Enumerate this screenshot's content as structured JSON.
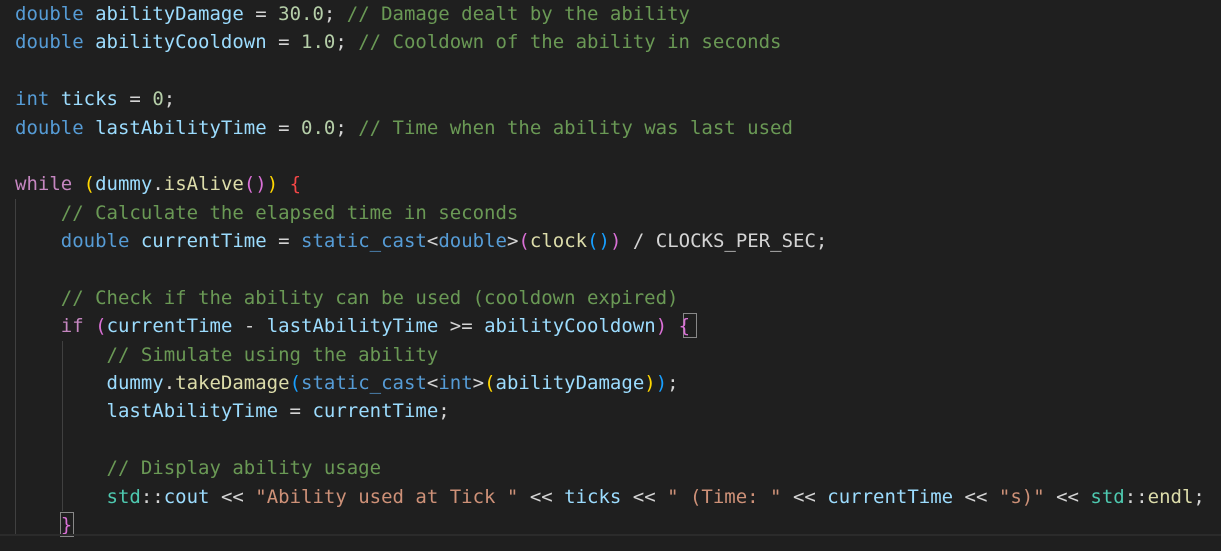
{
  "theme": {
    "background": "#1f1f1f",
    "keyword": "#569cd6",
    "control": "#c586c0",
    "variable": "#9cdcfe",
    "function": "#dcdcaa",
    "number": "#b5cea8",
    "comment": "#6a9955",
    "string": "#ce9178",
    "type": "#4ec9b0",
    "plain": "#d4d4d4",
    "bracket_1": "#ffd700",
    "bracket_2": "#da70d6",
    "bracket_3": "#179fff"
  },
  "code_lines": [
    {
      "role": "decl",
      "tokens": [
        {
          "t": "double",
          "c": "keyword"
        },
        {
          "t": " ",
          "c": "plain"
        },
        {
          "t": "abilityDamage",
          "c": "variable"
        },
        {
          "t": " = ",
          "c": "plain"
        },
        {
          "t": "30.0",
          "c": "number"
        },
        {
          "t": "; ",
          "c": "plain"
        },
        {
          "t": "// Damage dealt by the ability",
          "c": "comment"
        }
      ]
    },
    {
      "role": "decl",
      "tokens": [
        {
          "t": "double",
          "c": "keyword"
        },
        {
          "t": " ",
          "c": "plain"
        },
        {
          "t": "abilityCooldown",
          "c": "variable"
        },
        {
          "t": " = ",
          "c": "plain"
        },
        {
          "t": "1.0",
          "c": "number"
        },
        {
          "t": "; ",
          "c": "plain"
        },
        {
          "t": "// Cooldown of the ability in seconds",
          "c": "comment"
        }
      ]
    },
    {
      "role": "blank",
      "tokens": []
    },
    {
      "role": "decl",
      "tokens": [
        {
          "t": "int",
          "c": "keyword"
        },
        {
          "t": " ",
          "c": "plain"
        },
        {
          "t": "ticks",
          "c": "variable"
        },
        {
          "t": " = ",
          "c": "plain"
        },
        {
          "t": "0",
          "c": "number"
        },
        {
          "t": ";",
          "c": "plain"
        }
      ]
    },
    {
      "role": "decl",
      "tokens": [
        {
          "t": "double",
          "c": "keyword"
        },
        {
          "t": " ",
          "c": "plain"
        },
        {
          "t": "lastAbilityTime",
          "c": "variable"
        },
        {
          "t": " = ",
          "c": "plain"
        },
        {
          "t": "0.0",
          "c": "number"
        },
        {
          "t": "; ",
          "c": "plain"
        },
        {
          "t": "// Time when the ability was last used",
          "c": "comment"
        }
      ]
    },
    {
      "role": "blank",
      "tokens": []
    },
    {
      "role": "loop",
      "tokens": [
        {
          "t": "while",
          "c": "control"
        },
        {
          "t": " ",
          "c": "plain"
        },
        {
          "t": "(",
          "c": "bracket_1"
        },
        {
          "t": "dummy",
          "c": "variable"
        },
        {
          "t": ".",
          "c": "plain"
        },
        {
          "t": "isAlive",
          "c": "function"
        },
        {
          "t": "()",
          "c": "bracket_2"
        },
        {
          "t": ")",
          "c": "bracket_1"
        },
        {
          "t": " ",
          "c": "plain"
        },
        {
          "t": "{",
          "c": "red"
        }
      ]
    },
    {
      "role": "comment",
      "tokens": [
        {
          "t": "    ",
          "c": "plain"
        },
        {
          "t": "// Calculate the elapsed time in seconds",
          "c": "comment"
        }
      ]
    },
    {
      "role": "decl",
      "tokens": [
        {
          "t": "    ",
          "c": "plain"
        },
        {
          "t": "double",
          "c": "keyword"
        },
        {
          "t": " ",
          "c": "plain"
        },
        {
          "t": "currentTime",
          "c": "variable"
        },
        {
          "t": " = ",
          "c": "plain"
        },
        {
          "t": "static_cast",
          "c": "keyword"
        },
        {
          "t": "<",
          "c": "plain"
        },
        {
          "t": "double",
          "c": "keyword"
        },
        {
          "t": ">",
          "c": "plain"
        },
        {
          "t": "(",
          "c": "bracket_2"
        },
        {
          "t": "clock",
          "c": "function"
        },
        {
          "t": "()",
          "c": "bracket_3"
        },
        {
          "t": ")",
          "c": "bracket_2"
        },
        {
          "t": " / ",
          "c": "plain"
        },
        {
          "t": "CLOCKS_PER_SEC",
          "c": "plain"
        },
        {
          "t": ";",
          "c": "plain"
        }
      ]
    },
    {
      "role": "blank",
      "tokens": []
    },
    {
      "role": "comment",
      "tokens": [
        {
          "t": "    ",
          "c": "plain"
        },
        {
          "t": "// Check if the ability can be used (cooldown expired)",
          "c": "comment"
        }
      ]
    },
    {
      "role": "if",
      "tokens": [
        {
          "t": "    ",
          "c": "plain"
        },
        {
          "t": "if",
          "c": "control"
        },
        {
          "t": " ",
          "c": "plain"
        },
        {
          "t": "(",
          "c": "bracket_2"
        },
        {
          "t": "currentTime",
          "c": "variable"
        },
        {
          "t": " - ",
          "c": "plain"
        },
        {
          "t": "lastAbilityTime",
          "c": "variable"
        },
        {
          "t": " >= ",
          "c": "plain"
        },
        {
          "t": "abilityCooldown",
          "c": "variable"
        },
        {
          "t": ")",
          "c": "bracket_2"
        },
        {
          "t": " ",
          "c": "plain"
        },
        {
          "t": "{",
          "c": "bracket_2"
        }
      ]
    },
    {
      "role": "comment",
      "tokens": [
        {
          "t": "        ",
          "c": "plain"
        },
        {
          "t": "// Simulate using the ability",
          "c": "comment"
        }
      ]
    },
    {
      "role": "call",
      "tokens": [
        {
          "t": "        ",
          "c": "plain"
        },
        {
          "t": "dummy",
          "c": "variable"
        },
        {
          "t": ".",
          "c": "plain"
        },
        {
          "t": "takeDamage",
          "c": "function"
        },
        {
          "t": "(",
          "c": "bracket_3"
        },
        {
          "t": "static_cast",
          "c": "keyword"
        },
        {
          "t": "<",
          "c": "plain"
        },
        {
          "t": "int",
          "c": "keyword"
        },
        {
          "t": ">",
          "c": "plain"
        },
        {
          "t": "(",
          "c": "bracket_1"
        },
        {
          "t": "abilityDamage",
          "c": "variable"
        },
        {
          "t": ")",
          "c": "bracket_1"
        },
        {
          "t": ")",
          "c": "bracket_3"
        },
        {
          "t": ";",
          "c": "plain"
        }
      ]
    },
    {
      "role": "assign",
      "tokens": [
        {
          "t": "        ",
          "c": "plain"
        },
        {
          "t": "lastAbilityTime",
          "c": "variable"
        },
        {
          "t": " = ",
          "c": "plain"
        },
        {
          "t": "currentTime",
          "c": "variable"
        },
        {
          "t": ";",
          "c": "plain"
        }
      ]
    },
    {
      "role": "blank",
      "tokens": []
    },
    {
      "role": "comment",
      "tokens": [
        {
          "t": "        ",
          "c": "plain"
        },
        {
          "t": "// Display ability usage",
          "c": "comment"
        }
      ]
    },
    {
      "role": "output",
      "tokens": [
        {
          "t": "        ",
          "c": "plain"
        },
        {
          "t": "std",
          "c": "type"
        },
        {
          "t": "::",
          "c": "plain"
        },
        {
          "t": "cout",
          "c": "variable"
        },
        {
          "t": " << ",
          "c": "plain"
        },
        {
          "t": "\"Ability used at Tick \"",
          "c": "string"
        },
        {
          "t": " << ",
          "c": "plain"
        },
        {
          "t": "ticks",
          "c": "variable"
        },
        {
          "t": " << ",
          "c": "plain"
        },
        {
          "t": "\" (Time: \"",
          "c": "string"
        },
        {
          "t": " << ",
          "c": "plain"
        },
        {
          "t": "currentTime",
          "c": "variable"
        },
        {
          "t": " << ",
          "c": "plain"
        },
        {
          "t": "\"s)\"",
          "c": "string"
        },
        {
          "t": " << ",
          "c": "plain"
        },
        {
          "t": "std",
          "c": "type"
        },
        {
          "t": "::",
          "c": "plain"
        },
        {
          "t": "endl",
          "c": "function"
        },
        {
          "t": ";",
          "c": "plain"
        }
      ]
    },
    {
      "role": "close",
      "tokens": [
        {
          "t": "    ",
          "c": "plain"
        },
        {
          "t": "}",
          "c": "bracket_2"
        }
      ]
    }
  ]
}
